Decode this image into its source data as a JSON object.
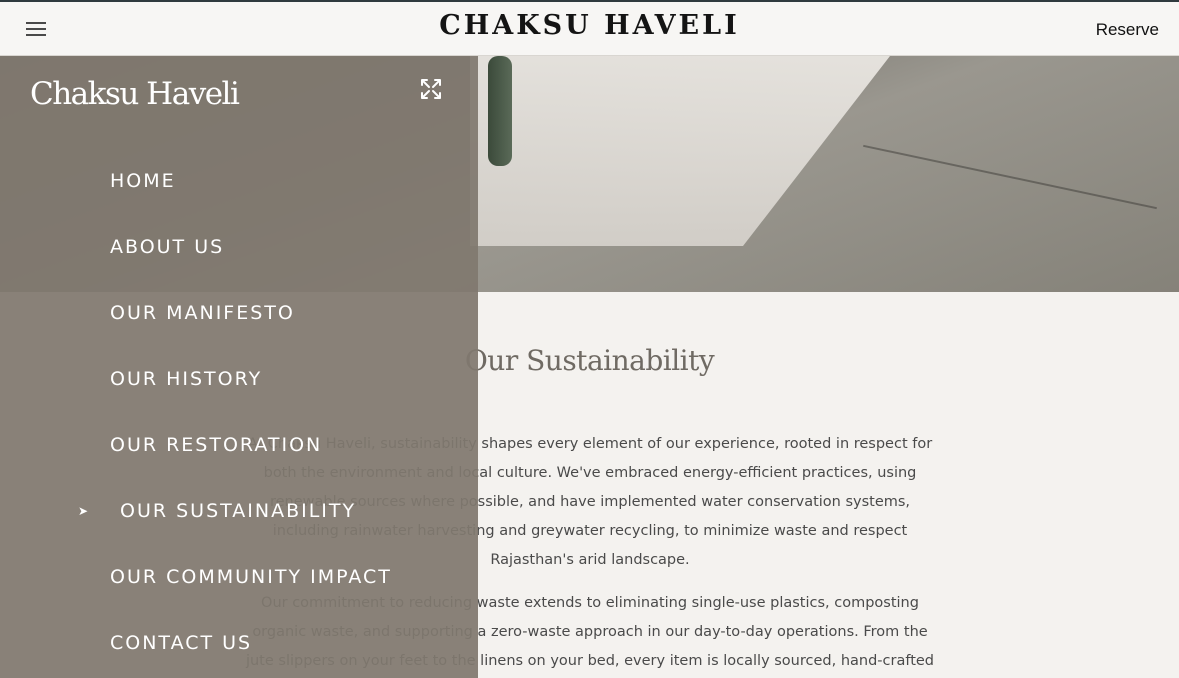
{
  "header": {
    "title": "CHAKSU HAVELI",
    "reserve_label": "Reserve",
    "menu_icon": "hamburger-icon"
  },
  "drawer": {
    "brand": "Chaksu Haveli",
    "close_icon": "close-icon",
    "nav": [
      {
        "label": "HOME",
        "active": false
      },
      {
        "label": "ABOUT US",
        "active": false
      },
      {
        "label": "OUR MANIFESTO",
        "active": false
      },
      {
        "label": "OUR HISTORY",
        "active": false
      },
      {
        "label": "OUR RESTORATION",
        "active": false
      },
      {
        "label": "OUR SUSTAINABILITY",
        "active": true
      },
      {
        "label": "OUR COMMUNITY IMPACT",
        "active": false
      },
      {
        "label": "CONTACT US",
        "active": false
      }
    ],
    "active_icon": "arrow-right-icon"
  },
  "main": {
    "section_title": "Our Sustainability",
    "paragraph_1": "At Chaksu Haveli, sustainability shapes every element of our experience, rooted in respect for both the environment and local culture. We've embraced energy-efficient practices, using renewable sources where possible, and have implemented water conservation systems, including rainwater harvesting and greywater recycling, to minimize waste and respect Rajasthan's arid landscape.",
    "paragraph_2": "Our commitment to reducing waste extends to eliminating single-use plastics, composting organic waste, and supporting a zero-waste approach in our day-to-day operations. From the jute slippers on your feet to the linens on your bed, every item is locally sourced, hand-crafted"
  },
  "colors": {
    "drawer_bg": "#80796f",
    "page_bg": "#f4f2ef",
    "title_color": "#6f6a63",
    "header_border": "#2f3a3e"
  }
}
